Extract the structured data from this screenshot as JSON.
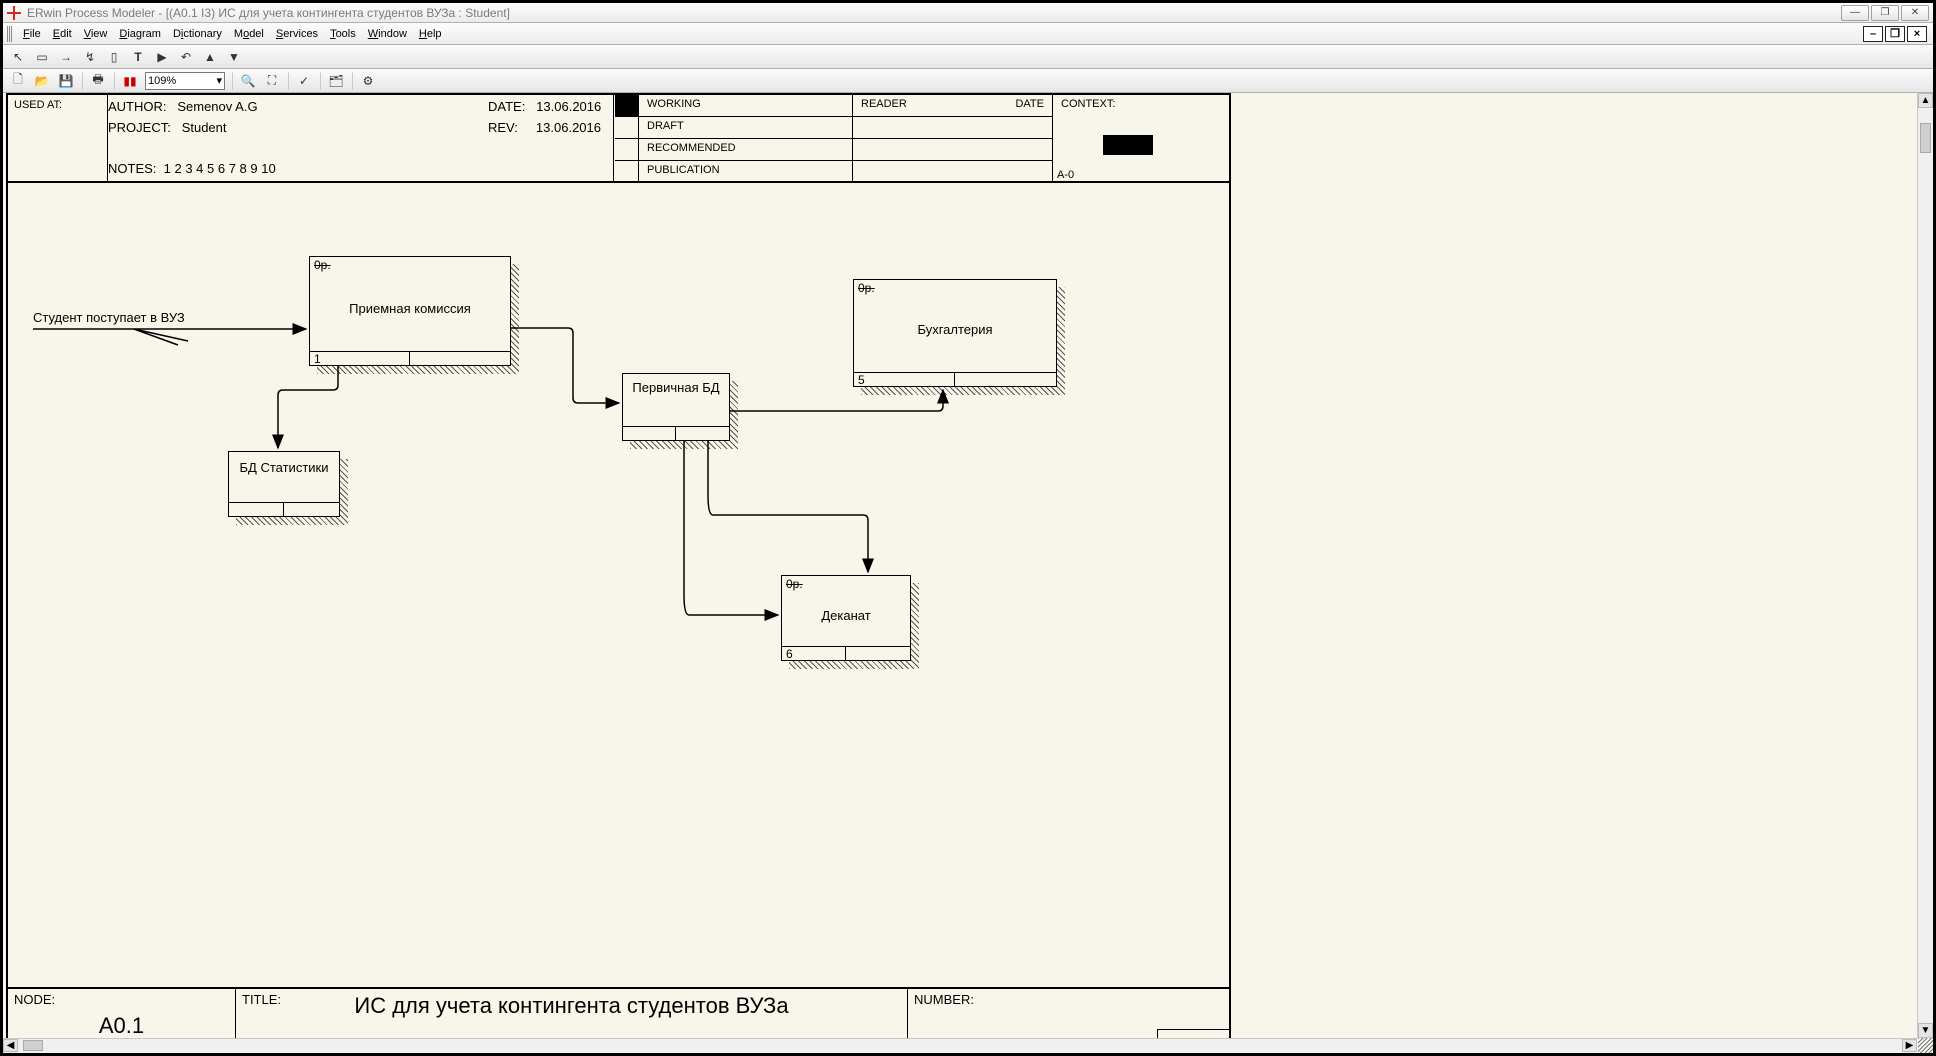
{
  "window": {
    "title": "ERwin Process Modeler - [(A0.1 I3) ИС для учета контингента студентов ВУЗа : Student]"
  },
  "menu": {
    "file": "File",
    "edit": "Edit",
    "view": "View",
    "diagram": "Diagram",
    "dictionary": "Dictionary",
    "model": "Model",
    "services": "Services",
    "tools": "Tools",
    "window": "Window",
    "help": "Help"
  },
  "toolbar2": {
    "zoom": "109%"
  },
  "header": {
    "used_at": "USED AT:",
    "author_lbl": "AUTHOR:",
    "author": "Semenov A.G",
    "project_lbl": "PROJECT:",
    "project": "Student",
    "date_lbl": "DATE:",
    "date": "13.06.2016",
    "rev_lbl": "REV:",
    "rev": "13.06.2016",
    "working": "WORKING",
    "draft": "DRAFT",
    "recommended": "RECOMMENDED",
    "publication": "PUBLICATION",
    "reader": "READER",
    "date2": "DATE",
    "context": "CONTEXT:",
    "context_code": "A-0",
    "notes_lbl": "NOTES:",
    "notes": "1  2  3  4  5  6  7  8  9  10"
  },
  "diagram": {
    "input_label": "Студент поступает в ВУЗ",
    "box1": {
      "tag": "0р.",
      "title": "Приемная комиссия",
      "num": "1"
    },
    "box2": {
      "tag": "0р.",
      "title": "Бухгалтерия",
      "num": "5"
    },
    "box3": {
      "title": "Первичная БД"
    },
    "box4": {
      "title": "БД Статистики"
    },
    "box5": {
      "tag": "0р.",
      "title": "Деканат",
      "num": "6"
    }
  },
  "footer": {
    "node_lbl": "NODE:",
    "node": "A0.1",
    "title_lbl": "TITLE:",
    "title": "ИС для учета контингента студентов ВУЗа",
    "number_lbl": "NUMBER:"
  }
}
